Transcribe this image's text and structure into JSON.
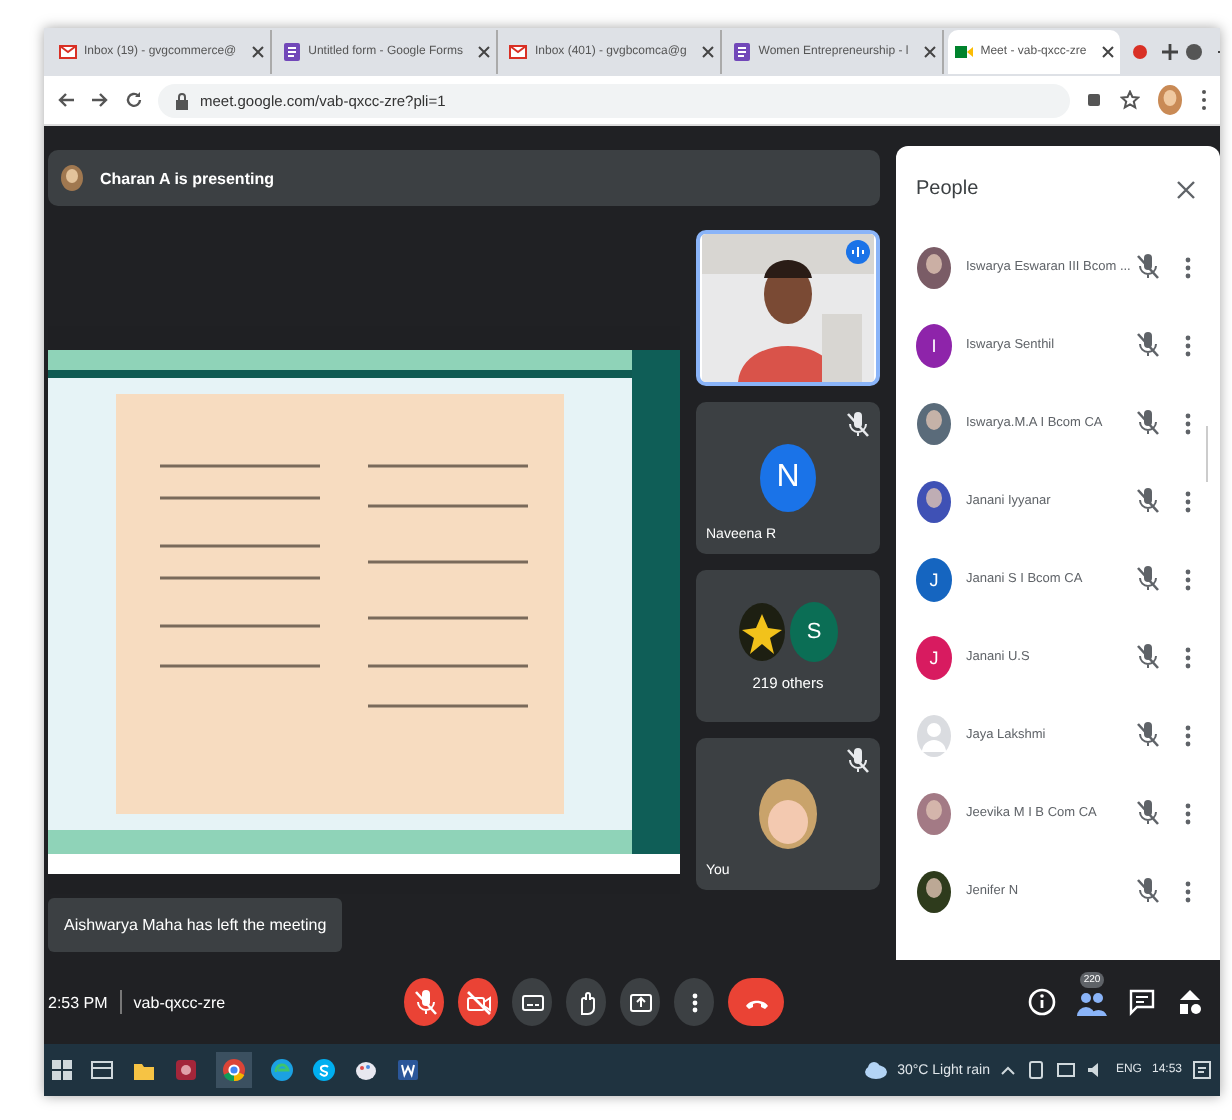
{
  "browser": {
    "tabs": [
      {
        "title": "Inbox (19) - gvgcommerce@",
        "kind": "mail",
        "selected": false
      },
      {
        "title": "Untitled form - Google Forms",
        "kind": "form",
        "selected": false
      },
      {
        "title": "Inbox (401) - gvgbcomca@g",
        "kind": "mail",
        "selected": false
      },
      {
        "title": "Women Entrepreneurship - l",
        "kind": "form",
        "selected": false
      },
      {
        "title": "Meet - vab-qxcc-zre",
        "kind": "meet",
        "selected": true
      }
    ],
    "url": "meet.google.com/vab-qxcc-zre?pli=1"
  },
  "meet": {
    "presenting": "Charan A is presenting",
    "toast": "Aishwarya Maha has left the meeting",
    "tiles": [
      {
        "kind": "video",
        "selected": true
      },
      {
        "kind": "avatar",
        "name": "Naveena R",
        "initial": "N",
        "color": "#1a73e8",
        "muted": true
      },
      {
        "kind": "group",
        "name": "219 others",
        "initial": "S",
        "color": "#0b6e55",
        "muted": false
      },
      {
        "name": "You",
        "color": "#c9a36b",
        "muted": true
      }
    ]
  },
  "people": {
    "title": "People",
    "participants": [
      {
        "name": "Iswarya Eswaran III Bcom ...",
        "color": "#7a5c66",
        "muted": true
      },
      {
        "name": "Iswarya Senthil",
        "kind": "initial",
        "initial": "I",
        "color": "#8e24aa",
        "muted": true
      },
      {
        "name": "Iswarya.M.A I Bcom CA",
        "color": "#5a6b7a",
        "muted": true
      },
      {
        "name": "Janani Iyyanar",
        "color": "#3f51b5",
        "muted": true
      },
      {
        "name": "Janani S I Bcom CA",
        "kind": "initial",
        "initial": "J",
        "color": "#1565c0",
        "muted": true
      },
      {
        "name": "Janani U.S",
        "kind": "initial",
        "initial": "J",
        "color": "#d81b60",
        "muted": true
      },
      {
        "name": "Jaya Lakshmi",
        "kind": "default",
        "color": "#dadce0",
        "muted": true
      },
      {
        "name": "Jeevika M I B Com CA",
        "color": "#a37a85",
        "muted": true
      },
      {
        "name": "Jenifer N",
        "color": "#2e3b1c",
        "muted": true
      }
    ]
  },
  "controls": {
    "time": "2:53 PM",
    "code": "vab-qxcc-zre",
    "buttons": [
      {
        "kind": "mic",
        "off": true
      },
      {
        "kind": "camera",
        "off": true
      },
      {
        "kind": "captions",
        "off": false
      },
      {
        "kind": "hand",
        "off": false
      },
      {
        "kind": "present",
        "off": false
      },
      {
        "kind": "more",
        "off": false
      },
      {
        "kind": "leave",
        "off": true
      }
    ],
    "people_count": "220"
  },
  "taskbar": {
    "weather": "30°C Light rain",
    "language": "ENG",
    "clock": "14:53"
  }
}
